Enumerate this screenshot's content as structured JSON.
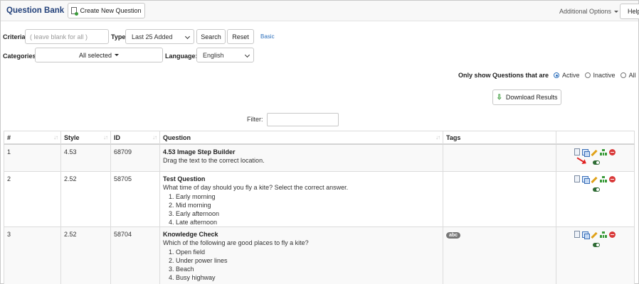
{
  "header": {
    "title": "Question Bank",
    "create_button": "Create New Question",
    "additional_options": "Additional Options",
    "help_button": "Help"
  },
  "search": {
    "criteria_label": "Criteria",
    "criteria_placeholder": "( leave blank for all )",
    "type_label": "Type",
    "type_value": "Last 25 Added",
    "search_button": "Search",
    "reset_button": "Reset",
    "basic_link": "Basic",
    "categories_label": "Categories",
    "categories_value": "All selected",
    "language_label": "Language:",
    "language_value": "English"
  },
  "status_filter": {
    "label": "Only show Questions that are",
    "options": [
      "Active",
      "Inactive",
      "All"
    ],
    "selected": "Active"
  },
  "download_button": "Download Results",
  "filter_label": "Filter:",
  "table": {
    "columns": [
      "#",
      "Style",
      "ID",
      "Question",
      "Tags"
    ],
    "rows": [
      {
        "num": "1",
        "style": "4.53",
        "id": "68709",
        "title": "4.53 Image Step Builder",
        "desc": "Drag the text to the correct location.",
        "items": [],
        "tag": ""
      },
      {
        "num": "2",
        "style": "2.52",
        "id": "58705",
        "title": "Test Question",
        "desc": "What time of day should you fly a kite?  Select the correct answer.",
        "items": [
          "Early morning",
          "Mid morning",
          "Early afternoon",
          "Late afternoon"
        ],
        "tag": ""
      },
      {
        "num": "3",
        "style": "2.52",
        "id": "58704",
        "title": "Knowledge Check",
        "desc": "Which of the following are good places to fly a kite?",
        "items": [
          "Open field",
          "Under power lines",
          "Beach",
          "Busy highway"
        ],
        "tag": "abc"
      }
    ]
  },
  "colors": {
    "brand": "#23417a",
    "link": "#2a6ebb",
    "delete": "#d93a3a",
    "toggle_on": "#2e6b34",
    "highlight_arrow": "#e02020"
  }
}
